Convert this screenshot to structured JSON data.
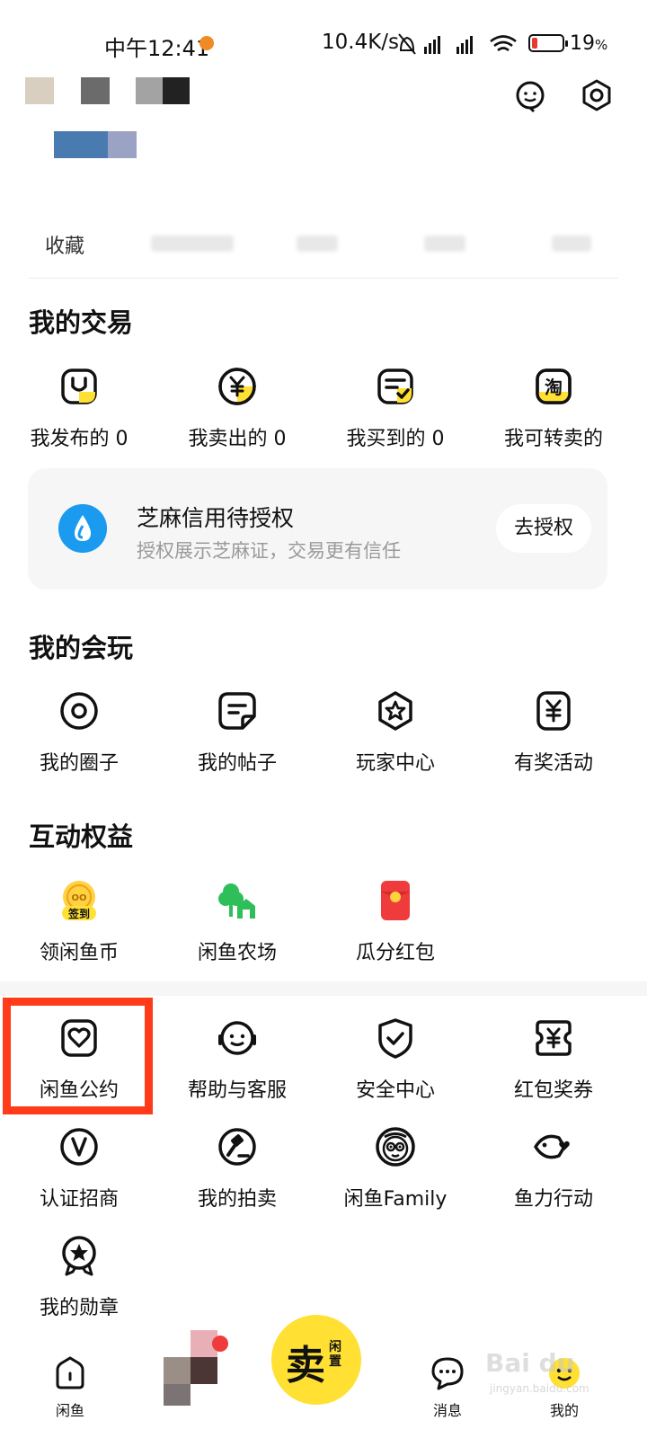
{
  "status_bar": {
    "time": "中午12:41",
    "network_speed": "10.4K/s",
    "battery_percent": "19",
    "battery_unit": "%",
    "battery_level": 0.19
  },
  "header": {
    "tabs": [
      {
        "label": "收藏"
      }
    ]
  },
  "trading": {
    "title": "我的交易",
    "items": [
      {
        "label": "我发布的 0",
        "icon": "publish-icon"
      },
      {
        "label": "我卖出的 0",
        "icon": "yen-coin-icon"
      },
      {
        "label": "我买到的 0",
        "icon": "bought-icon"
      },
      {
        "label": "我可转卖的",
        "icon": "taobao-icon"
      }
    ]
  },
  "sesame_card": {
    "title": "芝麻信用待授权",
    "subtitle": "授权展示芝麻证，交易更有信任",
    "button": "去授权"
  },
  "play": {
    "title": "我的会玩",
    "items": [
      {
        "label": "我的圈子",
        "icon": "circle-icon"
      },
      {
        "label": "我的帖子",
        "icon": "post-icon"
      },
      {
        "label": "玩家中心",
        "icon": "star-badge-icon"
      },
      {
        "label": "有奖活动",
        "icon": "yen-ticket-icon"
      }
    ]
  },
  "benefits": {
    "title": "互动权益",
    "items": [
      {
        "label": "领闲鱼币",
        "icon": "coin-checkin-icon",
        "badge": "签到"
      },
      {
        "label": "闲鱼农场",
        "icon": "farm-icon"
      },
      {
        "label": "瓜分红包",
        "icon": "red-packet-icon"
      }
    ]
  },
  "services": {
    "items": [
      {
        "label": "闲鱼公约",
        "icon": "heart-doc-icon"
      },
      {
        "label": "帮助与客服",
        "icon": "support-icon"
      },
      {
        "label": "安全中心",
        "icon": "shield-check-icon"
      },
      {
        "label": "红包奖券",
        "icon": "voucher-icon"
      },
      {
        "label": "认证招商",
        "icon": "verified-v-icon"
      },
      {
        "label": "我的拍卖",
        "icon": "auction-hammer-icon"
      },
      {
        "label": "闲鱼Family",
        "icon": "family-icon"
      },
      {
        "label": "鱼力行动",
        "icon": "fish-heart-icon"
      },
      {
        "label": "我的勋章",
        "icon": "medal-icon"
      }
    ]
  },
  "bottom_nav": {
    "items": [
      {
        "label": "闲鱼",
        "icon": "home-icon"
      },
      {
        "label": "消息",
        "icon": "message-icon"
      },
      {
        "label": "我的",
        "icon": "profile-icon"
      }
    ],
    "sell_main": "卖",
    "sell_side": "闲置"
  },
  "watermark": {
    "text": "Bai du",
    "sub": "jingyan.baidu.com"
  },
  "colors": {
    "accent_yellow": "#ffe033",
    "highlight_red": "#ff3b1a",
    "sesame_blue": "#1a9bef",
    "red_packet": "#ef3b3b",
    "farm_green": "#2fbf5a"
  }
}
